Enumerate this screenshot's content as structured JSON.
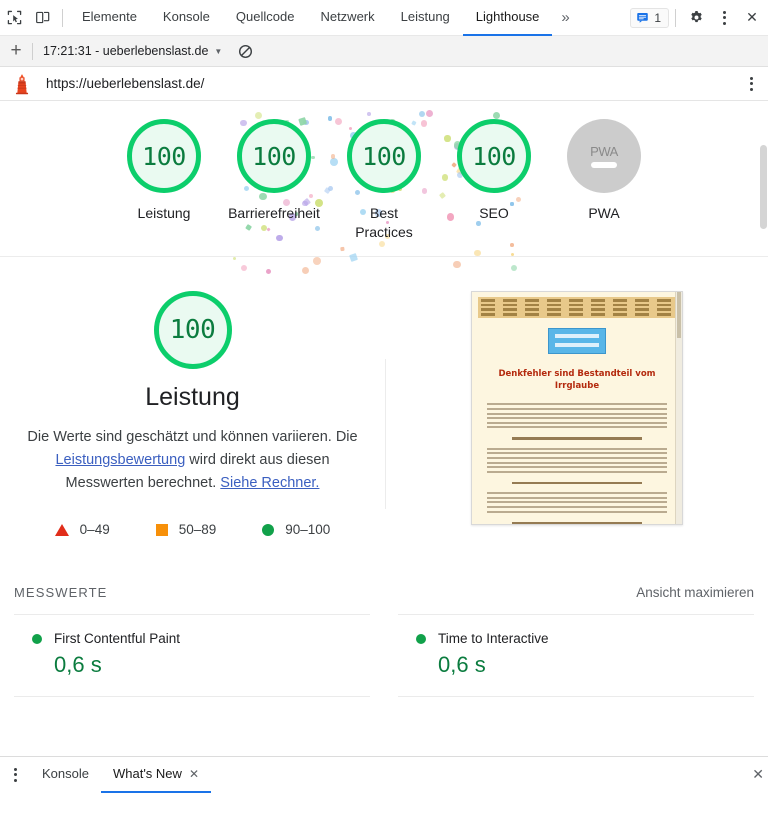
{
  "devtools": {
    "icons": {
      "inspect": "inspect-element-icon",
      "device": "device-toolbar-icon",
      "settings": "gear-icon",
      "main_menu": "kebab-menu-icon",
      "close": "close-icon",
      "issues": "issues-message-icon"
    },
    "tabs": [
      {
        "label": "Elemente",
        "active": false
      },
      {
        "label": "Konsole",
        "active": false
      },
      {
        "label": "Quellcode",
        "active": false
      },
      {
        "label": "Netzwerk",
        "active": false
      },
      {
        "label": "Leistung",
        "active": false
      },
      {
        "label": "Lighthouse",
        "active": true
      }
    ],
    "more_tabs": "»",
    "issues_count": "1",
    "close_label": "✕"
  },
  "lighthouse_toolbar": {
    "add_label": "+",
    "run_selection": "17:21:31 - ueberlebenslast.de",
    "caret": "▼",
    "clear_icon": "clear-all-icon"
  },
  "url_bar": {
    "logo": "lighthouse-logo-icon",
    "url": "https://ueberlebenslast.de/",
    "menu": "kebab-menu-icon"
  },
  "scores": [
    {
      "value": "100",
      "label": "Leistung",
      "state": "pass"
    },
    {
      "value": "100",
      "label": "Barrierefreiheit",
      "state": "pass"
    },
    {
      "value": "100",
      "label": "Best Practices",
      "state": "pass"
    },
    {
      "value": "100",
      "label": "SEO",
      "state": "pass"
    },
    {
      "value": "—",
      "label": "PWA",
      "state": "na",
      "badge_text": "PWA"
    }
  ],
  "category": {
    "score": "100",
    "title": "Leistung",
    "description_part1": "Die Werte sind geschätzt und können variieren. Die ",
    "link1": "Leistungsbewertung",
    "description_part2": " wird direkt aus diesen Messwerten berechnet. ",
    "link2": "Siehe Rechner.",
    "legend": [
      {
        "shape": "triangle",
        "range": "0–49",
        "color": "#e12d1a"
      },
      {
        "shape": "square",
        "range": "50–89",
        "color": "#f79009"
      },
      {
        "shape": "circle",
        "range": "90–100",
        "color": "#11a14a"
      }
    ]
  },
  "thumbnail": {
    "heading": "Denkfehler sind Bestandteil vom Irrglaube",
    "alt": "website-screenshot"
  },
  "metrics": {
    "section_title": "MESSWERTE",
    "toggle_label": "Ansicht maximieren",
    "items": [
      {
        "name": "First Contentful Paint",
        "value": "0,6 s",
        "state": "pass"
      },
      {
        "name": "Time to Interactive",
        "value": "0,6 s",
        "state": "pass"
      }
    ]
  },
  "drawer": {
    "menu": "kebab-menu-icon",
    "tabs": [
      {
        "label": "Konsole",
        "active": false,
        "closable": false
      },
      {
        "label": "What's New",
        "active": true,
        "closable": true
      }
    ],
    "close_label": "✕",
    "tab_close": "✕"
  },
  "colors": {
    "pass_green": "#0cce6b",
    "pass_text": "#0b7c3f",
    "average_orange": "#f79009",
    "fail_red": "#e12d1a",
    "accent_blue": "#1a73e8",
    "na_gray": "#cccccc"
  }
}
